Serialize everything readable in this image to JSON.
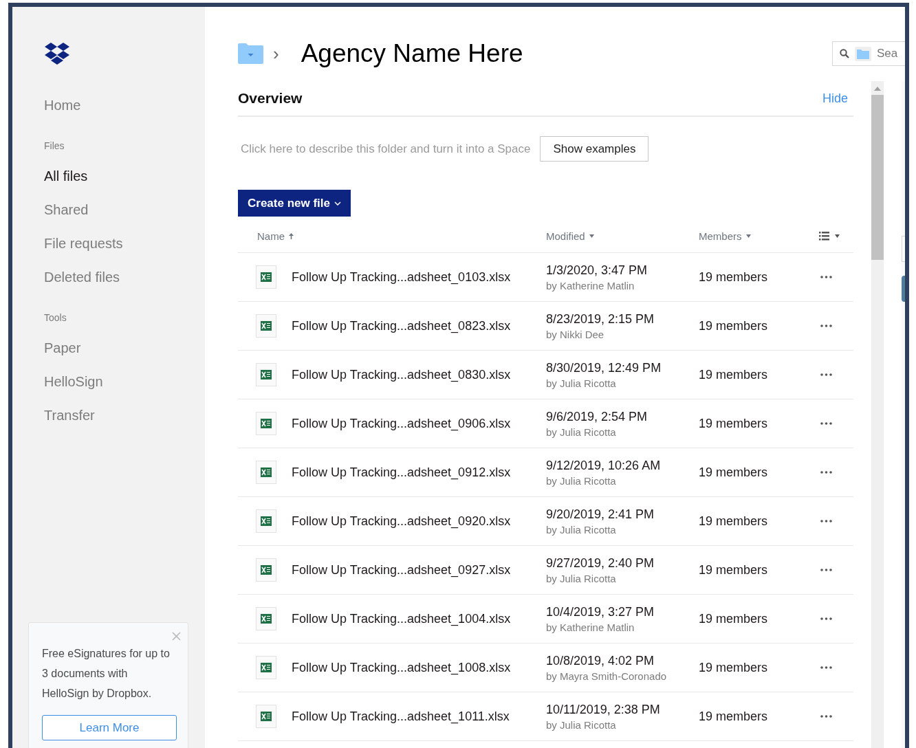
{
  "sidebar": {
    "items": [
      {
        "label": "Home",
        "selected": false
      }
    ],
    "sections": [
      {
        "heading": "Files",
        "items": [
          {
            "label": "All files",
            "selected": true
          },
          {
            "label": "Shared",
            "selected": false
          },
          {
            "label": "File requests",
            "selected": false
          },
          {
            "label": "Deleted files",
            "selected": false
          }
        ]
      },
      {
        "heading": "Tools",
        "items": [
          {
            "label": "Paper",
            "selected": false
          },
          {
            "label": "HelloSign",
            "selected": false
          },
          {
            "label": "Transfer",
            "selected": false
          }
        ]
      }
    ],
    "promo": {
      "text": "Free eSignatures for up to 3 documents with HelloSign by Dropbox.",
      "button": "Learn More"
    }
  },
  "header": {
    "breadcrumb_separator": "›",
    "title": "Agency Name Here",
    "search": {
      "placeholder": "Sea"
    }
  },
  "overview": {
    "title": "Overview",
    "hide": "Hide",
    "description": "Click here to describe this folder and turn it into a Space",
    "button": "Show examples"
  },
  "create_button": "Create new file",
  "table": {
    "columns": [
      {
        "label": "Name",
        "sorted": true
      },
      {
        "label": "Modified",
        "sorted": false
      },
      {
        "label": "Members",
        "sorted": false
      }
    ],
    "rows": [
      {
        "name": "Follow Up Tracking...adsheet_0103.xlsx",
        "modified": "1/3/2020, 3:47 PM",
        "by": "by Katherine Matlin",
        "members": "19 members"
      },
      {
        "name": "Follow Up Tracking...adsheet_0823.xlsx",
        "modified": "8/23/2019, 2:15 PM",
        "by": "by Nikki Dee",
        "members": "19 members"
      },
      {
        "name": "Follow Up Tracking...adsheet_0830.xlsx",
        "modified": "8/30/2019, 12:49 PM",
        "by": "by Julia Ricotta",
        "members": "19 members"
      },
      {
        "name": "Follow Up Tracking...adsheet_0906.xlsx",
        "modified": "9/6/2019, 2:54 PM",
        "by": "by Julia Ricotta",
        "members": "19 members"
      },
      {
        "name": "Follow Up Tracking...adsheet_0912.xlsx",
        "modified": "9/12/2019, 10:26 AM",
        "by": "by Julia Ricotta",
        "members": "19 members"
      },
      {
        "name": "Follow Up Tracking...adsheet_0920.xlsx",
        "modified": "9/20/2019, 2:41 PM",
        "by": "by Julia Ricotta",
        "members": "19 members"
      },
      {
        "name": "Follow Up Tracking...adsheet_0927.xlsx",
        "modified": "9/27/2019, 2:40 PM",
        "by": "by Julia Ricotta",
        "members": "19 members"
      },
      {
        "name": "Follow Up Tracking...adsheet_1004.xlsx",
        "modified": "10/4/2019, 3:27 PM",
        "by": "by Katherine Matlin",
        "members": "19 members"
      },
      {
        "name": "Follow Up Tracking...adsheet_1008.xlsx",
        "modified": "10/8/2019, 4:02 PM",
        "by": "by Mayra Smith-Coronado",
        "members": "19 members"
      },
      {
        "name": "Follow Up Tracking...adsheet_1011.xlsx",
        "modified": "10/11/2019, 2:38 PM",
        "by": "by Julia Ricotta",
        "members": "19 members"
      }
    ]
  }
}
